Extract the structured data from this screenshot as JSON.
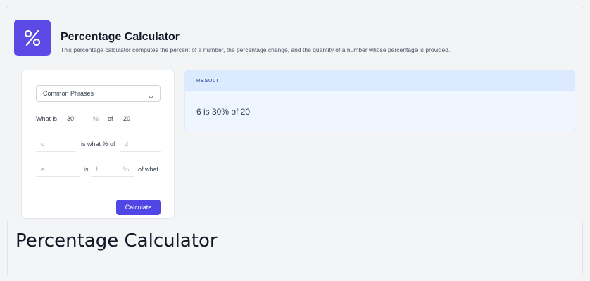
{
  "header": {
    "icon": "percent-icon",
    "title": "Percentage Calculator",
    "description": "This percentage calculator computes the percent of a number, the percentage change, and the quantity of a number whose percentage is provided."
  },
  "form": {
    "mode_select": {
      "value": "Common Phrases",
      "icon": "chevron-down-icon"
    },
    "row1": {
      "prefix": "What is",
      "percent_value": "30",
      "percent_unit": "%",
      "middle": "of",
      "base_value": "20"
    },
    "row2": {
      "input_c_placeholder": "c",
      "middle": "is what % of",
      "input_d_placeholder": "d"
    },
    "row3": {
      "input_e_placeholder": "e",
      "middle": "is",
      "input_f_placeholder": "f",
      "percent_unit": "%",
      "suffix": "of what"
    },
    "calculate_label": "Calculate"
  },
  "result": {
    "heading": "RESULT",
    "text": "6 is 30% of 20"
  },
  "caption": "Percentage Calculator",
  "colors": {
    "accent": "#4f46e5",
    "result_bg": "#eff6ff",
    "result_header_bg": "#dbeafe"
  }
}
